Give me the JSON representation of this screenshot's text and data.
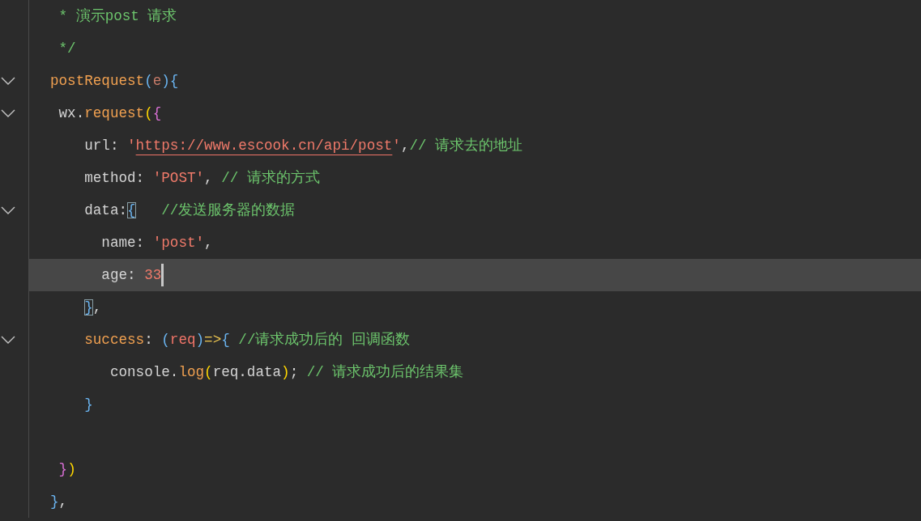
{
  "editor": {
    "lines": [
      {
        "foldable": false,
        "current": false,
        "tokens": [
          {
            "text": " * 演示post 请求",
            "kind": "comment"
          }
        ]
      },
      {
        "foldable": false,
        "current": false,
        "tokens": [
          {
            "text": " */",
            "kind": "comment"
          }
        ]
      },
      {
        "foldable": true,
        "current": false,
        "tokens": [
          {
            "text": "postRequest",
            "kind": "func"
          },
          {
            "text": "(",
            "kind": "bracket_blue"
          },
          {
            "text": "e",
            "kind": "param"
          },
          {
            "text": "){",
            "kind": "bracket_blue"
          }
        ]
      },
      {
        "foldable": true,
        "current": false,
        "tokens": [
          {
            "text": " wx.",
            "kind": "prop"
          },
          {
            "text": "request",
            "kind": "func"
          },
          {
            "text": "(",
            "kind": "bracket_gold"
          },
          {
            "text": "{",
            "kind": "bracket_pink"
          }
        ]
      },
      {
        "foldable": false,
        "current": false,
        "tokens": [
          {
            "text": "    url: ",
            "kind": "prop"
          },
          {
            "text": "'",
            "kind": "string"
          },
          {
            "text": "https://www.escook.cn/api/post",
            "kind": "link"
          },
          {
            "text": "'",
            "kind": "string"
          },
          {
            "text": ",",
            "kind": "prop"
          },
          {
            "text": "// 请求去的地址",
            "kind": "comment"
          }
        ]
      },
      {
        "foldable": false,
        "current": false,
        "tokens": [
          {
            "text": "    method: ",
            "kind": "prop"
          },
          {
            "text": "'POST'",
            "kind": "string"
          },
          {
            "text": ", ",
            "kind": "prop"
          },
          {
            "text": "// 请求的方式",
            "kind": "comment"
          }
        ]
      },
      {
        "foldable": true,
        "current": false,
        "tokens": [
          {
            "text": "    data:",
            "kind": "prop"
          },
          {
            "text": "{",
            "kind": "match"
          },
          {
            "text": "   //发送服务器的数据",
            "kind": "comment"
          }
        ]
      },
      {
        "foldable": false,
        "current": false,
        "tokens": [
          {
            "text": "      name: ",
            "kind": "prop"
          },
          {
            "text": "'post'",
            "kind": "string"
          },
          {
            "text": ",",
            "kind": "prop"
          }
        ]
      },
      {
        "foldable": false,
        "current": true,
        "tokens": [
          {
            "text": "      age: ",
            "kind": "prop"
          },
          {
            "text": "33",
            "kind": "number"
          }
        ]
      },
      {
        "foldable": false,
        "current": false,
        "tokens": [
          {
            "text": "    }",
            "kind": "match"
          },
          {
            "text": ",",
            "kind": "prop"
          }
        ]
      },
      {
        "foldable": true,
        "current": false,
        "tokens": [
          {
            "text": "    success",
            "kind": "func"
          },
          {
            "text": ": ",
            "kind": "prop"
          },
          {
            "text": "(",
            "kind": "bracket_blue"
          },
          {
            "text": "req",
            "kind": "param2"
          },
          {
            "text": ")",
            "kind": "bracket_blue"
          },
          {
            "text": "=>",
            "kind": "op"
          },
          {
            "text": "{ ",
            "kind": "bracket_blue"
          },
          {
            "text": "//请求成功后的 回调函数",
            "kind": "comment"
          }
        ]
      },
      {
        "foldable": false,
        "current": false,
        "tokens": [
          {
            "text": "       console.",
            "kind": "prop"
          },
          {
            "text": "log",
            "kind": "func"
          },
          {
            "text": "(",
            "kind": "bracket_gold"
          },
          {
            "text": "req.data",
            "kind": "prop"
          },
          {
            "text": ")",
            "kind": "bracket_gold"
          },
          {
            "text": "; ",
            "kind": "prop"
          },
          {
            "text": "// 请求成功后的结果集",
            "kind": "comment"
          }
        ]
      },
      {
        "foldable": false,
        "current": false,
        "tokens": [
          {
            "text": "    }",
            "kind": "bracket_blue"
          }
        ]
      },
      {
        "foldable": false,
        "current": false
      },
      {
        "foldable": false,
        "current": false,
        "tokens": [
          {
            "text": " }",
            "kind": "bracket_pink"
          },
          {
            "text": ")",
            "kind": "bracket_gold"
          }
        ]
      },
      {
        "foldable": false,
        "current": false,
        "tokens": [
          {
            "text": "}",
            "kind": "bracket_blue"
          },
          {
            "text": ",",
            "kind": "prop"
          }
        ]
      }
    ]
  }
}
